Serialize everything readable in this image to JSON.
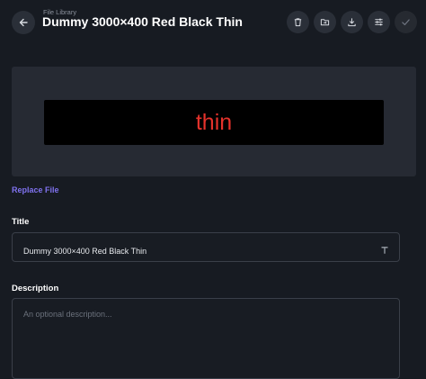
{
  "header": {
    "breadcrumb": "File Library",
    "title": "Dummy 3000×400 Red Black Thin"
  },
  "preview": {
    "banner_text": "thin",
    "text_color": "#e4322b",
    "background_color": "#000000"
  },
  "replace_file_label": "Replace File",
  "form": {
    "title_label": "Title",
    "title_value": "Dummy 3000×400 Red Black Thin",
    "description_label": "Description",
    "description_placeholder": "An optional description..."
  },
  "icons": {
    "back": "arrow-left-icon",
    "actions": [
      "trash-icon",
      "folder-move-icon",
      "download-icon",
      "sliders-icon",
      "check-icon"
    ],
    "field": "text-type-icon"
  },
  "colors": {
    "background": "#171b22",
    "accent": "#7f72ee"
  }
}
